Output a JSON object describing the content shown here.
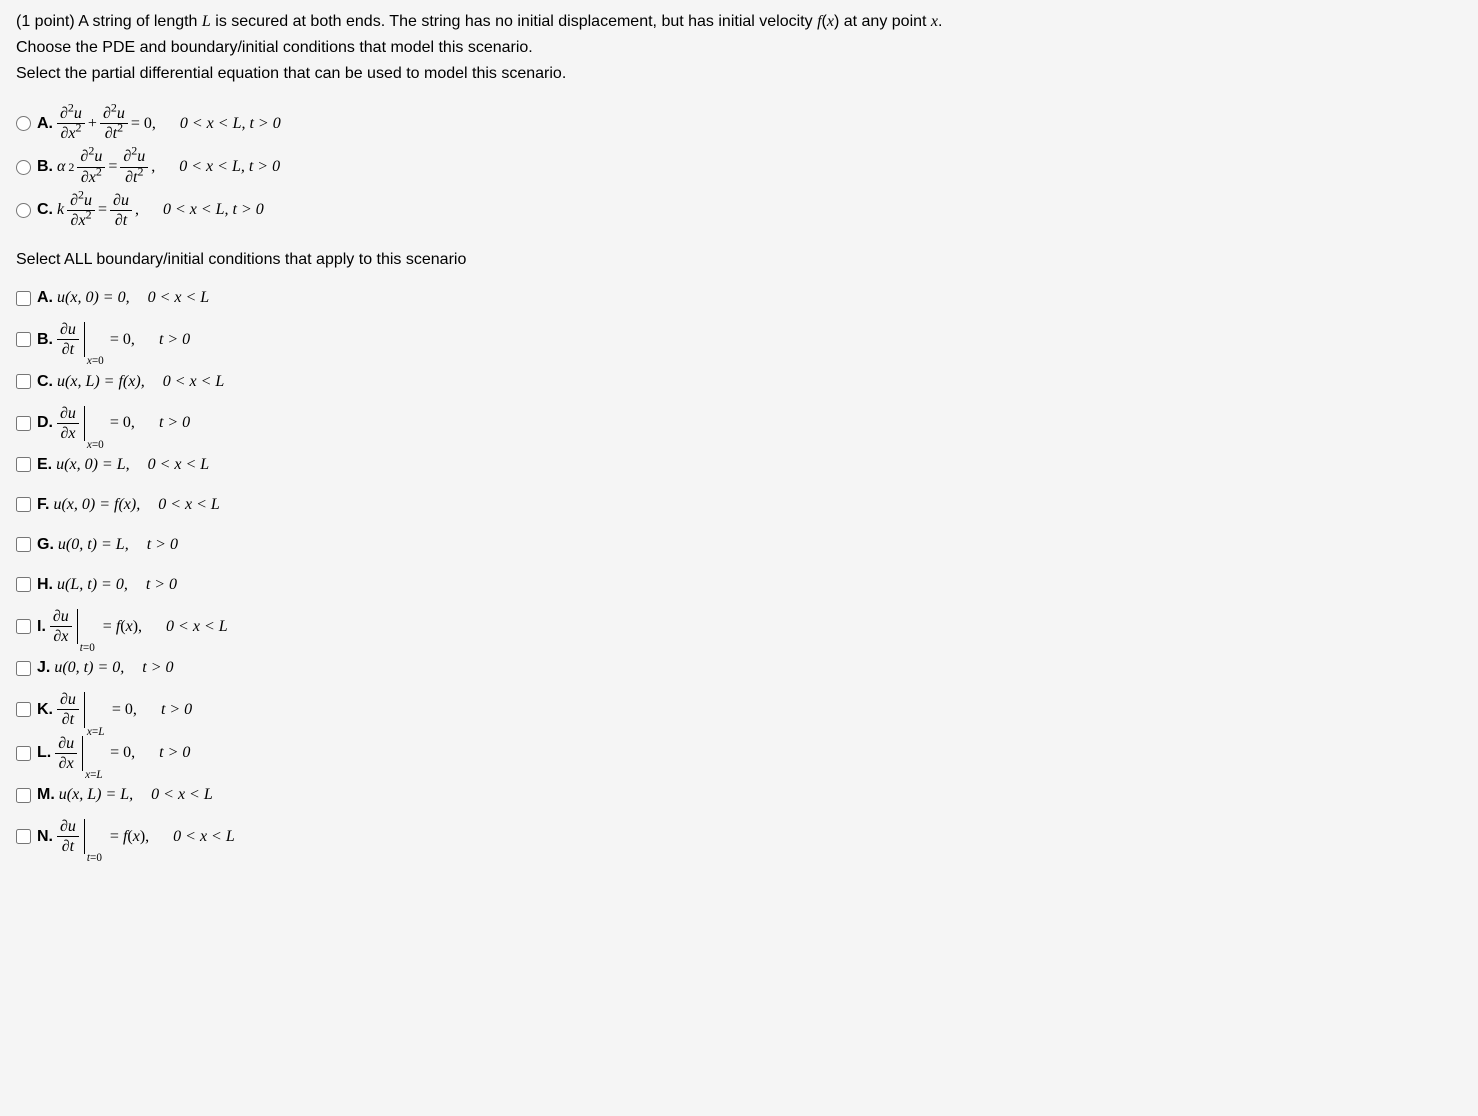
{
  "question": {
    "points_label": "(1 point)",
    "stem_line1": "A string of length L is secured at both ends. The string has no initial displacement, but has initial velocity f(x) at any point x.",
    "stem_line2": "Choose the PDE and boundary/initial conditions that model this scenario.",
    "stem_line3": "Select the partial differential equation that can be used to model this scenario."
  },
  "pde_choices": [
    {
      "letter": "A.",
      "domain": "0 < x < L, t > 0"
    },
    {
      "letter": "B.",
      "domain": "0 < x < L, t > 0"
    },
    {
      "letter": "C.",
      "domain": "0 < x < L, t > 0"
    }
  ],
  "bc_header": "Select ALL boundary/initial conditions that apply to this scenario",
  "bc_choices": {
    "A": {
      "letter": "A.",
      "expr": "u(x, 0) = 0,",
      "domain": "0 < x < L"
    },
    "B": {
      "letter": "B.",
      "rhs": "= 0,",
      "domain": "t > 0",
      "sub": "x=0"
    },
    "C": {
      "letter": "C.",
      "expr": "u(x, L) = f(x),",
      "domain": "0 < x < L"
    },
    "D": {
      "letter": "D.",
      "rhs": "= 0,",
      "domain": "t > 0",
      "sub": "x=0"
    },
    "E": {
      "letter": "E.",
      "expr": "u(x, 0) = L,",
      "domain": "0 < x < L"
    },
    "F": {
      "letter": "F.",
      "expr": "u(x, 0) = f(x),",
      "domain": "0 < x < L"
    },
    "G": {
      "letter": "G.",
      "expr": "u(0, t) = L,",
      "domain": "t > 0"
    },
    "H": {
      "letter": "H.",
      "expr": "u(L, t) = 0,",
      "domain": "t > 0"
    },
    "I": {
      "letter": "I.",
      "rhs": "= f(x),",
      "domain": "0 < x < L",
      "sub": "t=0"
    },
    "J": {
      "letter": "J.",
      "expr": "u(0, t) = 0,",
      "domain": "t > 0"
    },
    "K": {
      "letter": "K.",
      "rhs": "= 0,",
      "domain": "t > 0",
      "sub": "x=L"
    },
    "L": {
      "letter": "L.",
      "rhs": "= 0,",
      "domain": "t > 0",
      "sub": "x=L"
    },
    "M": {
      "letter": "M.",
      "expr": "u(x, L) = L,",
      "domain": "0 < x < L"
    },
    "N": {
      "letter": "N.",
      "rhs": "= f(x),",
      "domain": "0 < x < L",
      "sub": "t=0"
    }
  }
}
